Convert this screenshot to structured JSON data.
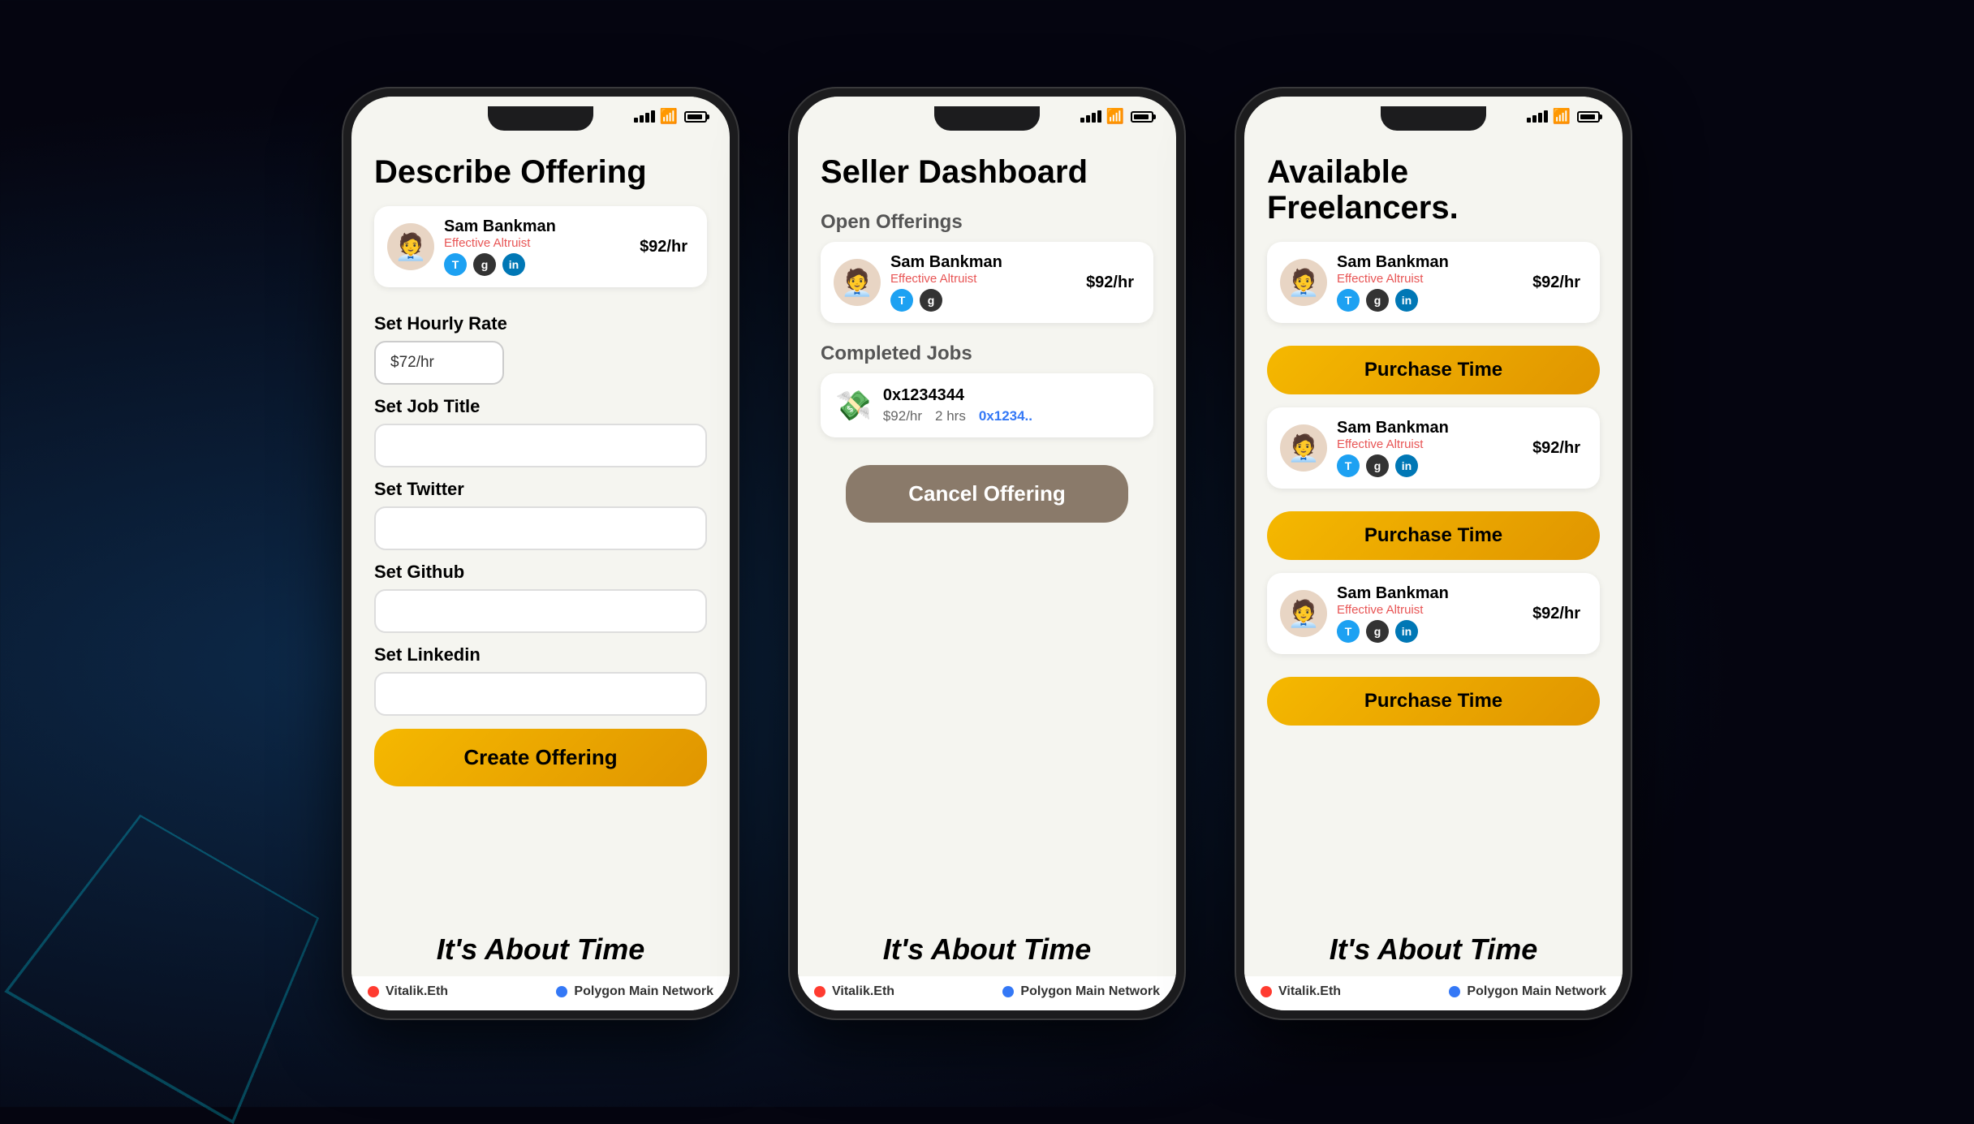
{
  "phones": [
    {
      "id": "describe-offering",
      "title": "Describe Offering",
      "user": {
        "name": "Sam Bankman",
        "rate": "$92/hr",
        "subtitle": "Effective Altruist",
        "avatar": "🧑‍💼"
      },
      "form": {
        "hourly_rate_label": "Set Hourly Rate",
        "hourly_rate_value": "$72/hr",
        "job_title_label": "Set Job Title",
        "job_title_value": "",
        "twitter_label": "Set Twitter",
        "twitter_value": "",
        "github_label": "Set Github",
        "github_value": "",
        "linkedin_label": "Set Linkedin",
        "linkedin_value": ""
      },
      "cta_button": "Create Offering",
      "tagline": "It's About Time",
      "footer": {
        "wallet": "Vitalik.Eth",
        "network": "Polygon Main Network"
      }
    },
    {
      "id": "seller-dashboard",
      "title": "Seller Dashboard",
      "open_offerings_label": "Open Offerings",
      "open_offering_user": {
        "name": "Sam Bankman",
        "rate": "$92/hr",
        "subtitle": "Effective Altruist",
        "avatar": "🧑‍💼"
      },
      "completed_jobs_label": "Completed Jobs",
      "job": {
        "emoji": "💸",
        "id": "0x1234344",
        "rate": "$92/hr",
        "hours": "2 hrs",
        "address": "0x1234.."
      },
      "cancel_button": "Cancel Offering",
      "tagline": "It's About Time",
      "footer": {
        "wallet": "Vitalik.Eth",
        "network": "Polygon Main Network"
      }
    },
    {
      "id": "available-freelancers",
      "title": "Available Freelancers.",
      "freelancers": [
        {
          "name": "Sam Bankman",
          "rate": "$92/hr",
          "subtitle": "Effective Altruist",
          "avatar": "🧑‍💼",
          "purchase_label": "Purchase Time"
        },
        {
          "name": "Sam Bankman",
          "rate": "$92/hr",
          "subtitle": "Effective Altruist",
          "avatar": "🧑‍💼",
          "purchase_label": "Purchase Time"
        },
        {
          "name": "Sam Bankman",
          "rate": "$92/hr",
          "subtitle": "Effective Altruist",
          "avatar": "🧑‍💼",
          "purchase_label": "Purchase Time"
        }
      ],
      "tagline": "It's About Time",
      "footer": {
        "wallet": "Vitalik.Eth",
        "network": "Polygon Main Network"
      }
    }
  ],
  "status": {
    "wallet_dot_color": "#ff3b30",
    "network_dot_color": "#3478f6"
  }
}
